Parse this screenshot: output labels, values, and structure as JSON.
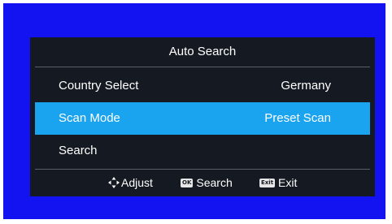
{
  "menu": {
    "title": "Auto Search",
    "rows": [
      {
        "label": "Country Select",
        "value": "Germany",
        "selected": false
      },
      {
        "label": "Scan Mode",
        "value": "Preset Scan",
        "selected": true
      },
      {
        "label": "Search",
        "value": "",
        "selected": false
      }
    ]
  },
  "footer": {
    "hints": [
      {
        "icon": "dpad-arrows-icon",
        "label": "Adjust"
      },
      {
        "icon": "ok-key-icon",
        "key_text": "OK",
        "label": "Search"
      },
      {
        "icon": "exit-key-icon",
        "key_text": "Exit",
        "label": "Exit"
      }
    ]
  },
  "colors": {
    "background": "#1313f2",
    "panel": "#151a22",
    "highlight": "#1aa3ee",
    "text": "#ffffff"
  }
}
